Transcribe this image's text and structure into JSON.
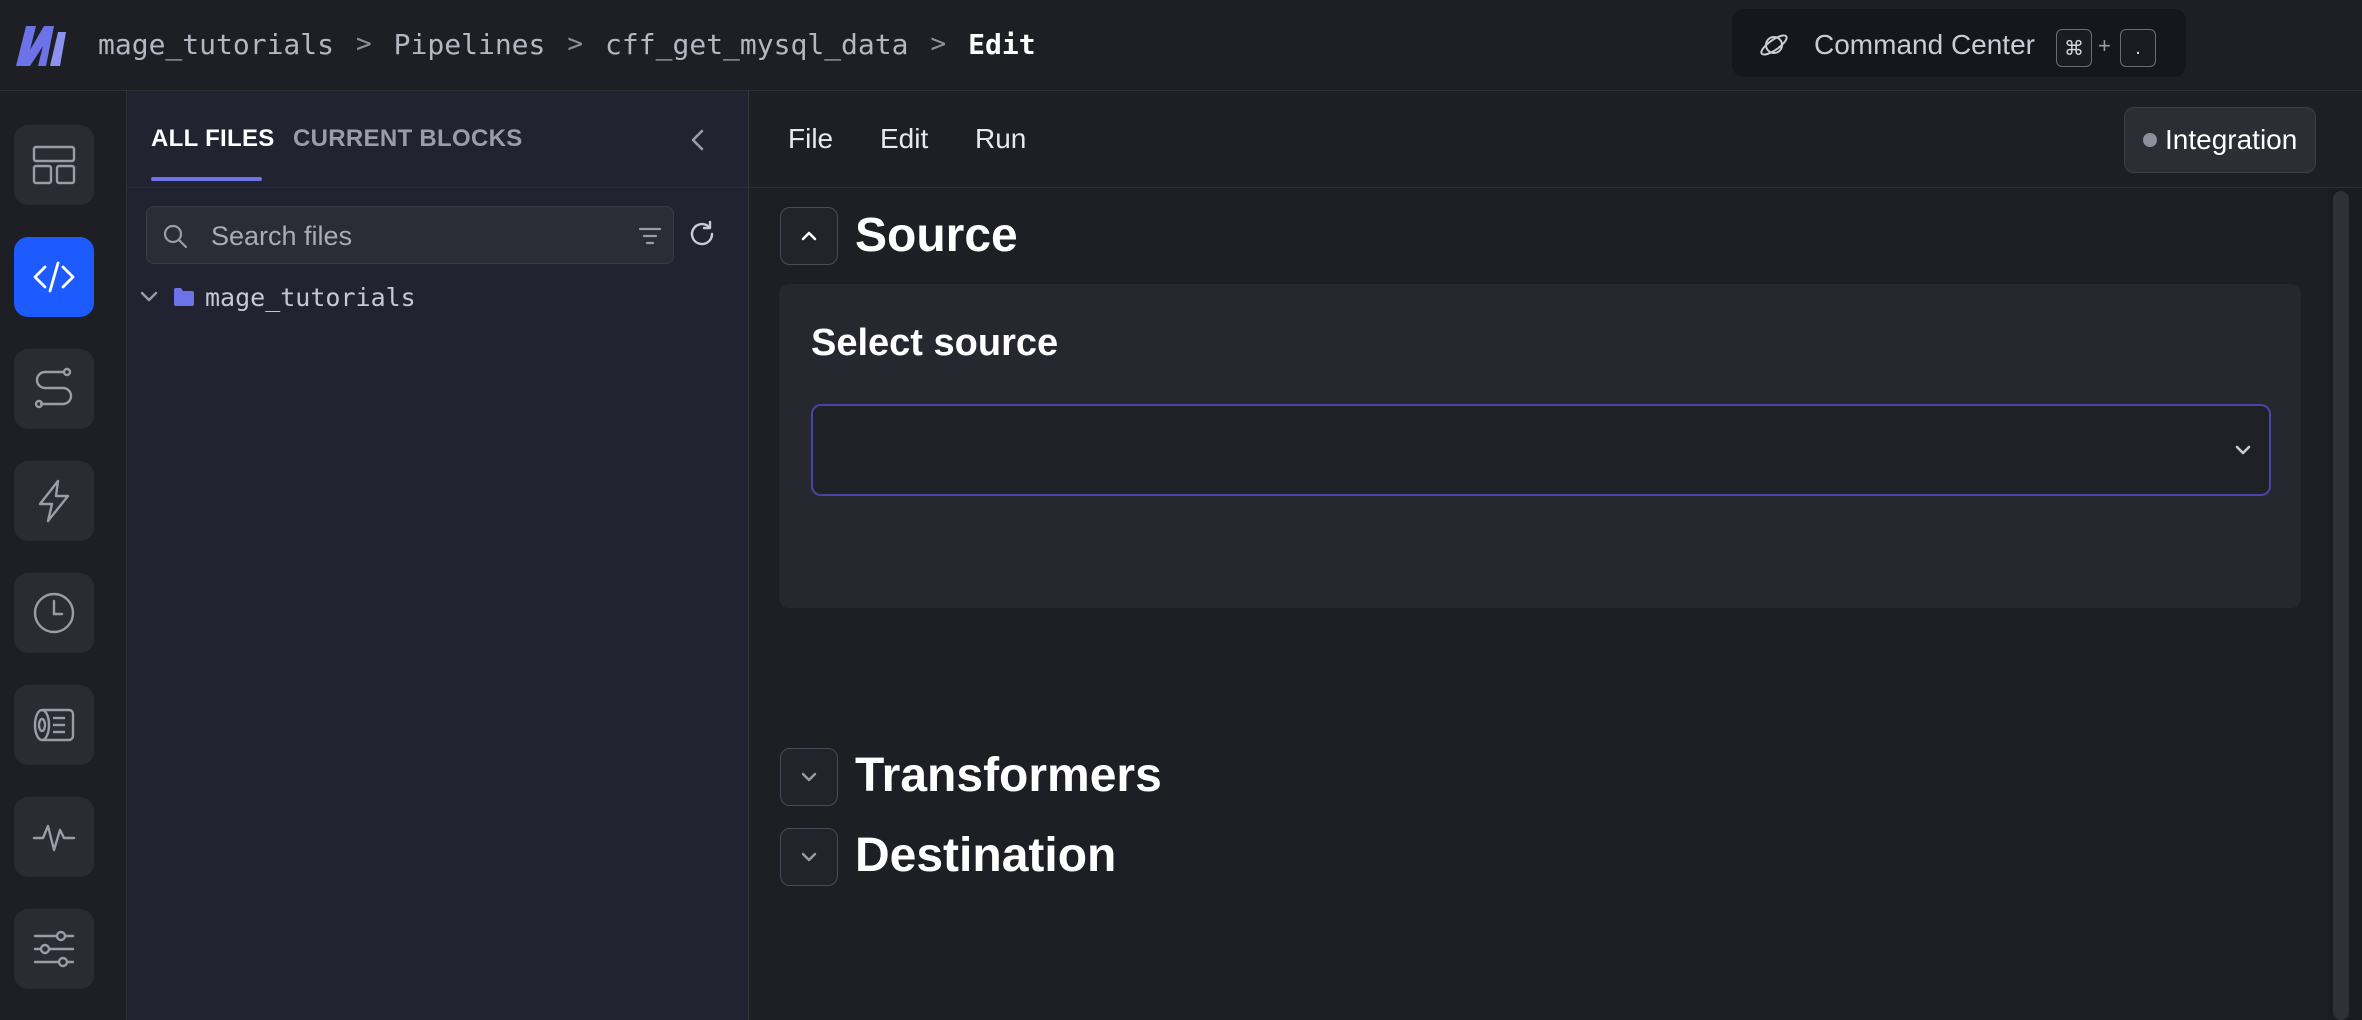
{
  "header": {
    "breadcrumb": [
      "mage_tutorials",
      "Pipelines",
      "cff_get_mysql_data",
      "Edit"
    ],
    "separator": ">",
    "command_center": {
      "label": "Command Center",
      "shortcut_key1": "⌘",
      "shortcut_plus": "+",
      "shortcut_key2": "."
    },
    "icons": {
      "logo": "mage-logo",
      "command_center": "planet-icon"
    }
  },
  "left_nav": {
    "items": [
      {
        "name": "overview",
        "icon": "layout-grid-icon",
        "active": false
      },
      {
        "name": "code-editor",
        "icon": "code-icon",
        "active": true
      },
      {
        "name": "pipeline",
        "icon": "route-icon",
        "active": false
      },
      {
        "name": "triggers",
        "icon": "lightning-icon",
        "active": false
      },
      {
        "name": "runs",
        "icon": "clock-icon",
        "active": false
      },
      {
        "name": "backfills",
        "icon": "film-roll-icon",
        "active": false
      },
      {
        "name": "monitor",
        "icon": "pulse-icon",
        "active": false
      },
      {
        "name": "settings",
        "icon": "sliders-icon",
        "active": false
      }
    ],
    "accent_color": "#1d5bff"
  },
  "file_panel": {
    "tabs": [
      {
        "label": "ALL FILES",
        "active": true
      },
      {
        "label": "CURRENT BLOCKS",
        "active": false
      }
    ],
    "search": {
      "placeholder": "Search files",
      "value": ""
    },
    "tree": [
      {
        "name": "mage_tutorials",
        "type": "folder",
        "expanded": false
      }
    ]
  },
  "main": {
    "menu": [
      "File",
      "Edit",
      "Run"
    ],
    "pipeline_type_badge": "Integration",
    "sections": {
      "source": {
        "title": "Source",
        "expanded": true,
        "select_label": "Select source",
        "select_value": ""
      },
      "transformers": {
        "title": "Transformers",
        "expanded": false
      },
      "destination": {
        "title": "Destination",
        "expanded": false
      }
    }
  }
}
